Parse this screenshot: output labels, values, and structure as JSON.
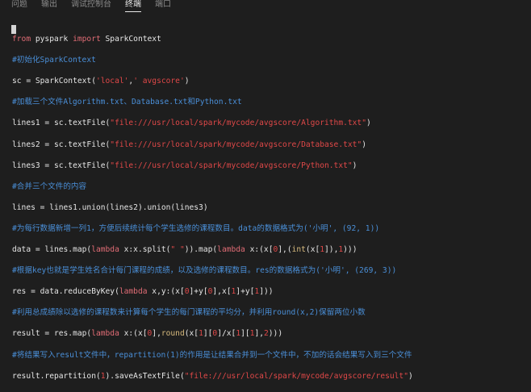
{
  "tabs": [
    {
      "label": "问题",
      "active": false
    },
    {
      "label": "输出",
      "active": false
    },
    {
      "label": "调试控制台",
      "active": false
    },
    {
      "label": "终端",
      "active": true
    },
    {
      "label": "端口",
      "active": false
    }
  ],
  "lines": [
    {
      "type": "code",
      "segments": [
        {
          "t": "from",
          "c": "kw"
        },
        {
          "t": " pyspark ",
          "c": "plain"
        },
        {
          "t": "import",
          "c": "kw"
        },
        {
          "t": " SparkContext",
          "c": "plain"
        }
      ]
    },
    {
      "type": "comment",
      "segments": [
        {
          "t": "#初始化SparkContext",
          "c": "comment"
        }
      ]
    },
    {
      "type": "code",
      "segments": [
        {
          "t": "sc = SparkContext(",
          "c": "plain"
        },
        {
          "t": "'local'",
          "c": "str"
        },
        {
          "t": ",",
          "c": "plain"
        },
        {
          "t": "' avgscore'",
          "c": "str"
        },
        {
          "t": ")",
          "c": "plain"
        }
      ]
    },
    {
      "type": "comment",
      "segments": [
        {
          "t": "#加载三个文件Algorithm.txt、Database.txt和Python.txt",
          "c": "comment"
        }
      ]
    },
    {
      "type": "code",
      "segments": [
        {
          "t": "lines1 = sc.textFile(",
          "c": "plain"
        },
        {
          "t": "\"file:///usr/local/spark/mycode/avgscore/Algorithm.txt\"",
          "c": "str"
        },
        {
          "t": ")",
          "c": "plain"
        }
      ]
    },
    {
      "type": "code",
      "segments": [
        {
          "t": "lines2 = sc.textFile(",
          "c": "plain"
        },
        {
          "t": "\"file:///usr/local/spark/mycode/avgscore/Database.txt\"",
          "c": "str"
        },
        {
          "t": ")",
          "c": "plain"
        }
      ]
    },
    {
      "type": "code",
      "segments": [
        {
          "t": "lines3 = sc.textFile(",
          "c": "plain"
        },
        {
          "t": "\"file:///usr/local/spark/mycode/avgscore/Python.txt\"",
          "c": "str"
        },
        {
          "t": ")",
          "c": "plain"
        }
      ]
    },
    {
      "type": "comment",
      "segments": [
        {
          "t": "#合并三个文件的内容",
          "c": "comment"
        }
      ]
    },
    {
      "type": "code",
      "segments": [
        {
          "t": "lines = lines1.union(lines2).union(lines3)",
          "c": "plain"
        }
      ]
    },
    {
      "type": "comment",
      "segments": [
        {
          "t": "#为每行数据新增一列1，方便后续统计每个学生选修的课程数目。data的数据格式为('小明', (92, 1))",
          "c": "comment"
        }
      ]
    },
    {
      "type": "code",
      "segments": [
        {
          "t": "data = lines.map(",
          "c": "plain"
        },
        {
          "t": "lambda",
          "c": "kw"
        },
        {
          "t": " x:x.split(",
          "c": "plain"
        },
        {
          "t": "\" \"",
          "c": "str"
        },
        {
          "t": ")).map(",
          "c": "plain"
        },
        {
          "t": "lambda",
          "c": "kw"
        },
        {
          "t": " x:(x[",
          "c": "plain"
        },
        {
          "t": "0",
          "c": "num"
        },
        {
          "t": "],(",
          "c": "plain"
        },
        {
          "t": "int",
          "c": "fn"
        },
        {
          "t": "(x[",
          "c": "plain"
        },
        {
          "t": "1",
          "c": "num"
        },
        {
          "t": "]),",
          "c": "plain"
        },
        {
          "t": "1",
          "c": "num"
        },
        {
          "t": ")))",
          "c": "plain"
        }
      ]
    },
    {
      "type": "comment",
      "segments": [
        {
          "t": "#根据key也就是学生姓名合计每门课程的成绩，以及选修的课程数目。res的数据格式为('小明', (269, 3))",
          "c": "comment"
        }
      ]
    },
    {
      "type": "code",
      "segments": [
        {
          "t": "res = data.reduceByKey(",
          "c": "plain"
        },
        {
          "t": "lambda",
          "c": "kw"
        },
        {
          "t": " x,y:(x[",
          "c": "plain"
        },
        {
          "t": "0",
          "c": "num"
        },
        {
          "t": "]+y[",
          "c": "plain"
        },
        {
          "t": "0",
          "c": "num"
        },
        {
          "t": "],x[",
          "c": "plain"
        },
        {
          "t": "1",
          "c": "num"
        },
        {
          "t": "]+y[",
          "c": "plain"
        },
        {
          "t": "1",
          "c": "num"
        },
        {
          "t": "]))",
          "c": "plain"
        }
      ]
    },
    {
      "type": "comment",
      "segments": [
        {
          "t": "#利用总成绩除以选修的课程数来计算每个学生的每门课程的平均分，并利用round(x,2)保留两位小数",
          "c": "comment"
        }
      ]
    },
    {
      "type": "code",
      "segments": [
        {
          "t": "result = res.map(",
          "c": "plain"
        },
        {
          "t": "lambda",
          "c": "kw"
        },
        {
          "t": " x:(x[",
          "c": "plain"
        },
        {
          "t": "0",
          "c": "num"
        },
        {
          "t": "],",
          "c": "plain"
        },
        {
          "t": "round",
          "c": "fn"
        },
        {
          "t": "(x[",
          "c": "plain"
        },
        {
          "t": "1",
          "c": "num"
        },
        {
          "t": "][",
          "c": "plain"
        },
        {
          "t": "0",
          "c": "num"
        },
        {
          "t": "]/x[",
          "c": "plain"
        },
        {
          "t": "1",
          "c": "num"
        },
        {
          "t": "][",
          "c": "plain"
        },
        {
          "t": "1",
          "c": "num"
        },
        {
          "t": "],",
          "c": "plain"
        },
        {
          "t": "2",
          "c": "num"
        },
        {
          "t": ")))",
          "c": "plain"
        }
      ]
    },
    {
      "type": "comment",
      "segments": [
        {
          "t": "#将结果写入result文件中，repartition(1)的作用是让结果合并到一个文件中，不加的话会结果写入到三个文件",
          "c": "comment"
        }
      ]
    },
    {
      "type": "code",
      "segments": [
        {
          "t": "result.repartition(",
          "c": "plain"
        },
        {
          "t": "1",
          "c": "num"
        },
        {
          "t": ").saveAsTextFile(",
          "c": "plain"
        },
        {
          "t": "\"file:///usr/local/spark/mycode/avgscore/result\"",
          "c": "str"
        },
        {
          "t": ")",
          "c": "plain"
        }
      ]
    }
  ]
}
